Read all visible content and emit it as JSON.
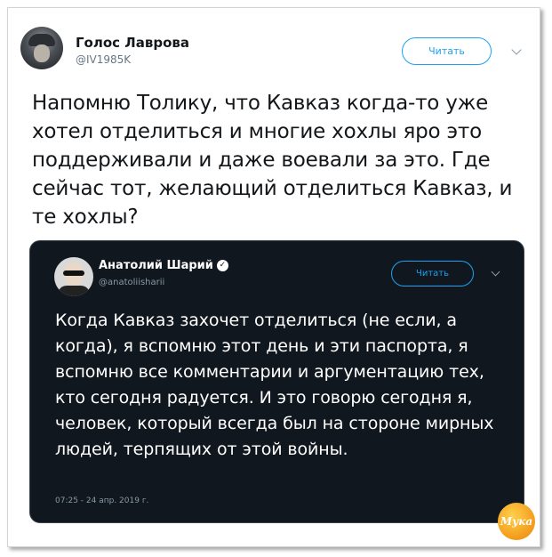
{
  "tweet": {
    "author_name": "Голос Лаврова",
    "author_handle": "@IV1985K",
    "follow_label": "Читать",
    "text": "Напомню Толику, что Кавказ когда-то уже хотел отделиться и многие хохлы яро это поддерживали и даже воевали за это. Где сейчас тот, желающий отделиться Кавказ, и те хохлы?"
  },
  "quoted_tweet": {
    "author_name": "Анатолий Шарий",
    "verified_icon": "✓",
    "author_handle": "@anatoliisharii",
    "follow_label": "Читать",
    "text": "Когда Кавказ захочет отделиться (не если, а когда), я вспомню этот день и эти паспорта, я вспомню все комментарии и аргументацию тех, кто сегодня радуется. И это говорю сегодня я, человек, который всегда был на стороне мирных людей, терпящих от этой войны.",
    "timestamp": "07:25 - 24 апр. 2019 г.",
    "theme_background": "#10171e"
  },
  "watermark": {
    "text": "Мука"
  },
  "colors": {
    "accent": "#1da1f2",
    "text_dark": "#14171a",
    "muted": "#657786"
  }
}
